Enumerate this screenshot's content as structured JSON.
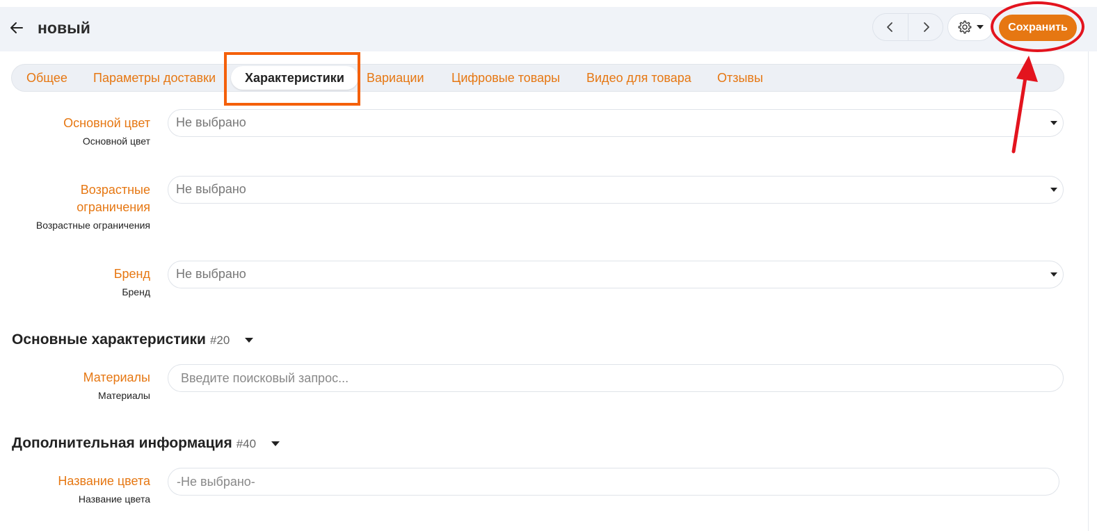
{
  "header": {
    "title": "новый",
    "save_label": "Сохранить"
  },
  "icons": {
    "back": "arrow-left-icon",
    "prev": "chevron-left-icon",
    "next": "chevron-right-icon",
    "settings": "gear-icon",
    "dropdown": "caret-down-icon"
  },
  "tabs": [
    {
      "label": "Общее",
      "active": false
    },
    {
      "label": "Параметры доставки",
      "active": false
    },
    {
      "label": "Характеристики",
      "active": true
    },
    {
      "label": "Вариации",
      "active": false
    },
    {
      "label": "Цифровые товары",
      "active": false
    },
    {
      "label": "Видео для товара",
      "active": false
    },
    {
      "label": "Отзывы",
      "active": false
    }
  ],
  "fields": {
    "main_color": {
      "label": "Основной цвет",
      "sublabel": "Основной цвет",
      "value": "Не выбрано"
    },
    "age": {
      "label_line1": "Возрастные",
      "label_line2": "ограничения",
      "sublabel": "Возрастные ограничения",
      "value": "Не выбрано"
    },
    "brand": {
      "label": "Бренд",
      "sublabel": "Бренд",
      "value": "Не выбрано"
    },
    "materials": {
      "label": "Материалы",
      "sublabel": "Материалы",
      "placeholder": "Введите поисковый запрос..."
    },
    "color_name": {
      "label": "Название цвета",
      "sublabel": "Название цвета",
      "placeholder": "-Не выбрано-"
    }
  },
  "sections": {
    "main": {
      "title": "Основные характеристики",
      "count": "#20"
    },
    "extra": {
      "title": "Дополнительная информация",
      "count": "#40"
    }
  },
  "colors": {
    "accent": "#e67712",
    "annotation_red": "#e3141e",
    "annotation_orange": "#f4600b"
  }
}
